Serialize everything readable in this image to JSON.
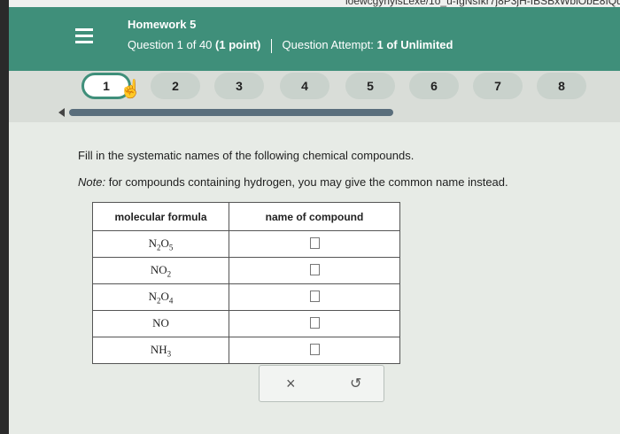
{
  "browser": {
    "url_fragment": "loewcgynyisLexe/1o_u-IgNsIkr7j8P3jH-IBSBxWblObE8IQdwns7sWgykl"
  },
  "header": {
    "menu_icon": "hamburger-menu-icon",
    "title": "Homework 5",
    "question_prefix": "Question 1 of 40",
    "question_points": "(1 point)",
    "attempt_prefix": "Question Attempt:",
    "attempt_value": "1 of Unlimited",
    "bg_color": "#3f8f7a"
  },
  "question_nav": {
    "items": [
      "1",
      "2",
      "3",
      "4",
      "5",
      "6",
      "7",
      "8"
    ],
    "active_index": 0
  },
  "question": {
    "instruction": "Fill in the systematic names of the following chemical compounds.",
    "note_label": "Note:",
    "note_text": "for compounds containing hydrogen, you may give the common name instead."
  },
  "table": {
    "headers": [
      "molecular formula",
      "name of compound"
    ],
    "rows": [
      {
        "el1": "N",
        "sub1": "2",
        "el2": "O",
        "sub2": "5"
      },
      {
        "el1": "N",
        "sub1": "",
        "el2": "O",
        "sub2": "2"
      },
      {
        "el1": "N",
        "sub1": "2",
        "el2": "O",
        "sub2": "4"
      },
      {
        "el1": "N",
        "sub1": "",
        "el2": "O",
        "sub2": ""
      },
      {
        "el1": "N",
        "sub1": "",
        "el2": "H",
        "sub2": "3"
      }
    ]
  },
  "actions": {
    "clear_symbol": "×",
    "undo_symbol": "↺",
    "clear_icon": "x-icon",
    "undo_icon": "undo-icon"
  }
}
